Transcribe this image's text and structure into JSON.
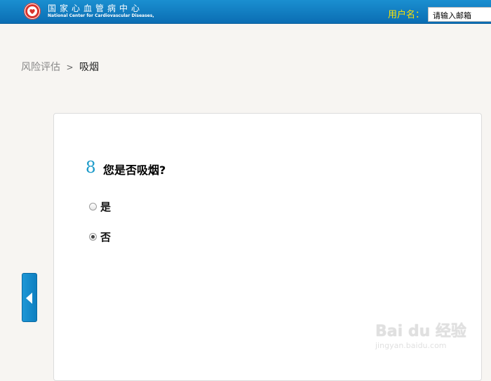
{
  "header": {
    "org_name_cn": "国家心血管病中心",
    "org_name_en": "National Center for Cardiovascular Diseases, Chin",
    "user_label": "用户名：",
    "user_input_placeholder": "请输入邮箱",
    "logo_icon": "ncc-heart-logo-icon",
    "colors": {
      "bar": "#0b6db3",
      "user_label": "#ffe400"
    }
  },
  "breadcrumb": {
    "parent": "风险评估",
    "separator": ">",
    "current": "吸烟"
  },
  "question": {
    "number": "8",
    "text": "您是否吸烟?",
    "options": [
      {
        "label": "是",
        "selected": false
      },
      {
        "label": "否",
        "selected": true
      }
    ]
  },
  "nav": {
    "prev_icon": "chevron-left-icon"
  },
  "watermark": {
    "logo_text": "Bai du 经验",
    "url": "jingyan.baidu.com"
  }
}
